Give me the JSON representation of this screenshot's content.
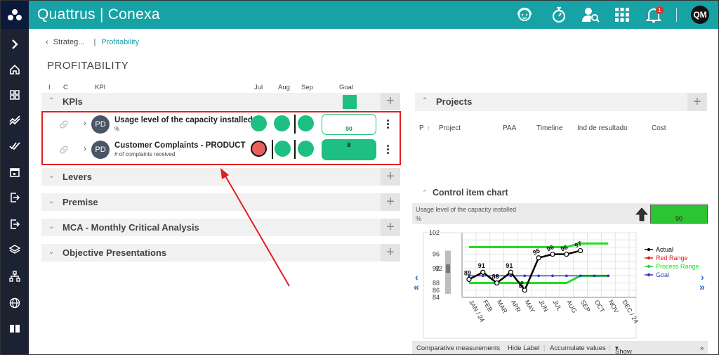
{
  "app": {
    "brand_left": "Quattrus",
    "brand_sep": "|",
    "brand_right": "Conexa",
    "user_initials": "QM",
    "notif_count": "1"
  },
  "breadcrumb": {
    "parent": "Strateg...",
    "separator": "|",
    "current": "Profitability"
  },
  "page_title": "PROFITABILITY",
  "kpi_columns": {
    "i": "I",
    "c": "C",
    "kpi": "KPI",
    "jul": "Jul",
    "aug": "Aug",
    "sep": "Sep",
    "goal": "Goal"
  },
  "sections": {
    "kpis": "KPIs",
    "levers": "Levers",
    "premise": "Premise",
    "mca": "MCA - Monthly Critical Analysis",
    "objective": "Objective Presentations"
  },
  "kpis": [
    {
      "owner": "PD",
      "name": "Usage level of the capacity installed",
      "unit": "%",
      "goal": "90",
      "status": [
        "green",
        "green",
        "green"
      ]
    },
    {
      "owner": "PD",
      "name": "Customer Complaints - PRODUCT",
      "unit": "# of complaints received",
      "goal": "8",
      "status": [
        "red",
        "green",
        "green"
      ]
    }
  ],
  "projects": {
    "title": "Projects",
    "columns": {
      "p": "P",
      "project": "Project",
      "paa": "PAA",
      "timeline": "Timeline",
      "result": "Ind de resultado",
      "cost": "Cost"
    }
  },
  "control_chart": {
    "title": "Control item chart",
    "kpi_name": "Usage level of the capacity installed",
    "unit": "%",
    "goal_value": "90",
    "footer": {
      "comparative": "Comparative measurements",
      "hide_label": "Hide Label",
      "accumulate": "Accumulate values",
      "show": "Show"
    }
  },
  "chart_data": {
    "type": "line",
    "categories": [
      "JAN / 24",
      "FEB",
      "MAR",
      "APR",
      "MAY",
      "JUN",
      "JUL",
      "AUG",
      "SEP",
      "OCT",
      "NOV",
      "DEC / 24"
    ],
    "ylim": [
      84,
      102
    ],
    "yticks": [
      84,
      86,
      88,
      92,
      96,
      102
    ],
    "side_marker": "92",
    "series": [
      {
        "name": "Actual",
        "color": "#000000",
        "values": [
          89,
          91,
          88,
          91,
          86,
          95,
          96,
          96,
          97,
          null,
          null,
          null
        ]
      },
      {
        "name": "Red Range",
        "color": "#e0211f",
        "values": []
      },
      {
        "name": "Process Range",
        "color": "#22dd22",
        "upper": [
          98,
          98,
          98,
          98,
          98,
          98,
          98,
          98,
          99,
          99,
          99,
          null
        ],
        "lower": [
          88,
          88,
          88,
          88,
          88,
          88,
          88,
          88,
          90,
          90,
          90,
          null
        ]
      },
      {
        "name": "Goal",
        "color": "#3333cc",
        "values": [
          90,
          90,
          90,
          90,
          90,
          90,
          90,
          90,
          90,
          90,
          90,
          null
        ]
      }
    ],
    "labels": [
      "89",
      "91",
      "88",
      "91",
      "86",
      "95",
      "96",
      "96",
      "97"
    ],
    "legend_position": "right"
  }
}
